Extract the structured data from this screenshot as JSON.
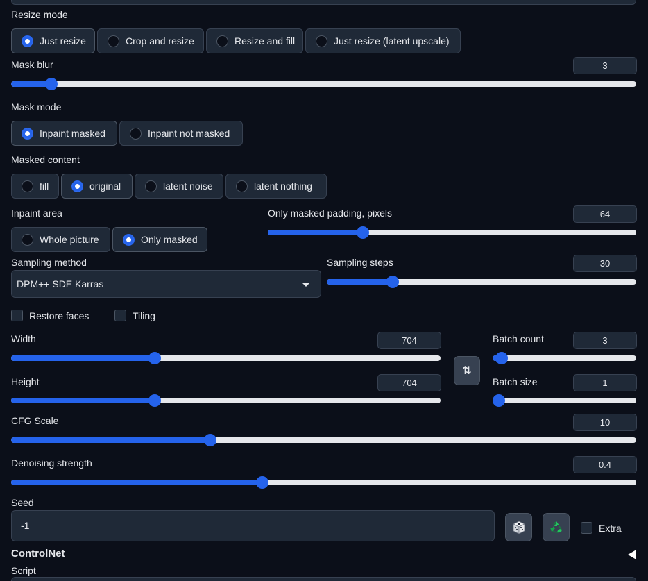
{
  "resize_mode": {
    "label": "Resize mode",
    "options": [
      "Just resize",
      "Crop and resize",
      "Resize and fill",
      "Just resize (latent upscale)"
    ],
    "selected": "Just resize"
  },
  "mask_blur": {
    "label": "Mask blur",
    "value": "3",
    "fraction": 0.055
  },
  "mask_mode": {
    "label": "Mask mode",
    "options": [
      "Inpaint masked",
      "Inpaint not masked"
    ],
    "selected": "Inpaint masked"
  },
  "masked_content": {
    "label": "Masked content",
    "options": [
      "fill",
      "original",
      "latent noise",
      "latent nothing"
    ],
    "selected": "original"
  },
  "inpaint_area": {
    "label": "Inpaint area",
    "options": [
      "Whole picture",
      "Only masked"
    ],
    "selected": "Only masked"
  },
  "only_masked_padding": {
    "label": "Only masked padding, pixels",
    "value": "64",
    "fraction": 0.25
  },
  "sampling_method": {
    "label": "Sampling method",
    "value": "DPM++ SDE Karras"
  },
  "sampling_steps": {
    "label": "Sampling steps",
    "value": "30",
    "fraction": 0.2
  },
  "restore_faces": {
    "label": "Restore faces",
    "checked": false
  },
  "tiling": {
    "label": "Tiling",
    "checked": false
  },
  "width": {
    "label": "Width",
    "value": "704",
    "fraction": 0.33
  },
  "height": {
    "label": "Height",
    "value": "704",
    "fraction": 0.33
  },
  "swap_button": {
    "glyph": "⇅"
  },
  "batch_count": {
    "label": "Batch count",
    "value": "3",
    "fraction": 0.02
  },
  "batch_size": {
    "label": "Batch size",
    "value": "1",
    "fraction": 0.0
  },
  "cfg_scale": {
    "label": "CFG Scale",
    "value": "10",
    "fraction": 0.315
  },
  "denoising_strength": {
    "label": "Denoising strength",
    "value": "0.4",
    "fraction": 0.4
  },
  "seed": {
    "label": "Seed",
    "value": "-1",
    "random_icon": "dice-icon",
    "reuse_icon": "recycle-icon",
    "extra_label": "Extra"
  },
  "controlnet": {
    "label": "ControlNet",
    "icon": "triangle-left-icon"
  },
  "script": {
    "label": "Script"
  }
}
